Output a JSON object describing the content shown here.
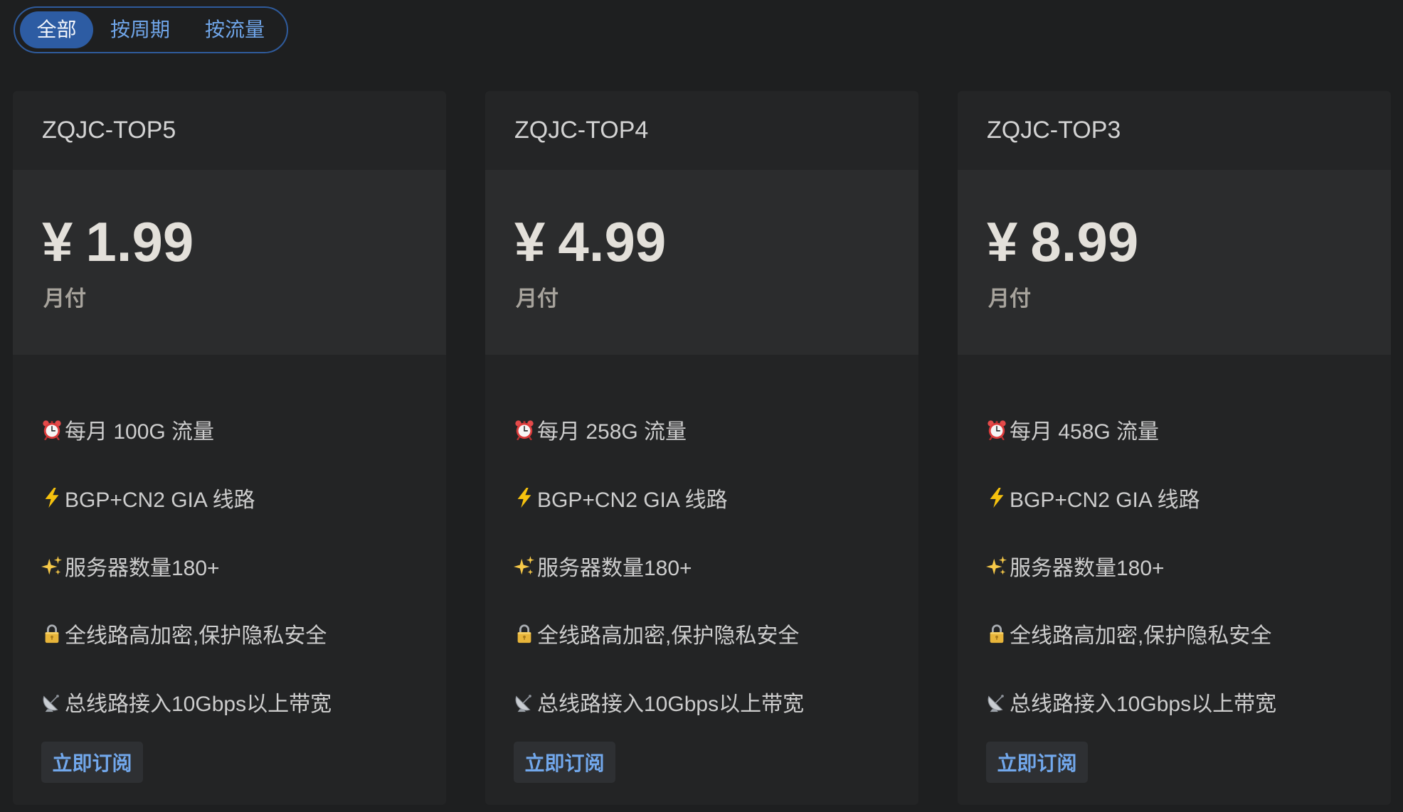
{
  "tabs": [
    {
      "label": "全部",
      "active": true
    },
    {
      "label": "按周期",
      "active": false
    },
    {
      "label": "按流量",
      "active": false
    }
  ],
  "colors": {
    "background": "#1e1f20",
    "accent": "#2d5ca3",
    "link_blue": "#72a8ec",
    "price_text": "#e3e0da"
  },
  "cards": [
    {
      "title": "ZQJC-TOP5",
      "price": {
        "currency": "¥",
        "amount": "1.99"
      },
      "period": "月付",
      "features": [
        {
          "icon": "alarm-clock-icon",
          "text": "每月 100G 流量"
        },
        {
          "icon": "lightning-icon",
          "text": "BGP+CN2 GIA 线路"
        },
        {
          "icon": "sparkles-icon",
          "text": "服务器数量180+"
        },
        {
          "icon": "lock-icon",
          "text": "全线路高加密,保护隐私安全"
        },
        {
          "icon": "satellite-antenna-icon",
          "text": "总线路接入10Gbps以上带宽"
        }
      ],
      "button_label": "立即订阅"
    },
    {
      "title": "ZQJC-TOP4",
      "price": {
        "currency": "¥",
        "amount": "4.99"
      },
      "period": "月付",
      "features": [
        {
          "icon": "alarm-clock-icon",
          "text": "每月 258G 流量"
        },
        {
          "icon": "lightning-icon",
          "text": "BGP+CN2 GIA 线路"
        },
        {
          "icon": "sparkles-icon",
          "text": "服务器数量180+"
        },
        {
          "icon": "lock-icon",
          "text": "全线路高加密,保护隐私安全"
        },
        {
          "icon": "satellite-antenna-icon",
          "text": "总线路接入10Gbps以上带宽"
        }
      ],
      "button_label": "立即订阅"
    },
    {
      "title": "ZQJC-TOP3",
      "price": {
        "currency": "¥",
        "amount": "8.99"
      },
      "period": "月付",
      "features": [
        {
          "icon": "alarm-clock-icon",
          "text": "每月 458G 流量"
        },
        {
          "icon": "lightning-icon",
          "text": "BGP+CN2 GIA 线路"
        },
        {
          "icon": "sparkles-icon",
          "text": "服务器数量180+"
        },
        {
          "icon": "lock-icon",
          "text": "全线路高加密,保护隐私安全"
        },
        {
          "icon": "satellite-antenna-icon",
          "text": "总线路接入10Gbps以上带宽"
        }
      ],
      "button_label": "立即订阅"
    }
  ]
}
